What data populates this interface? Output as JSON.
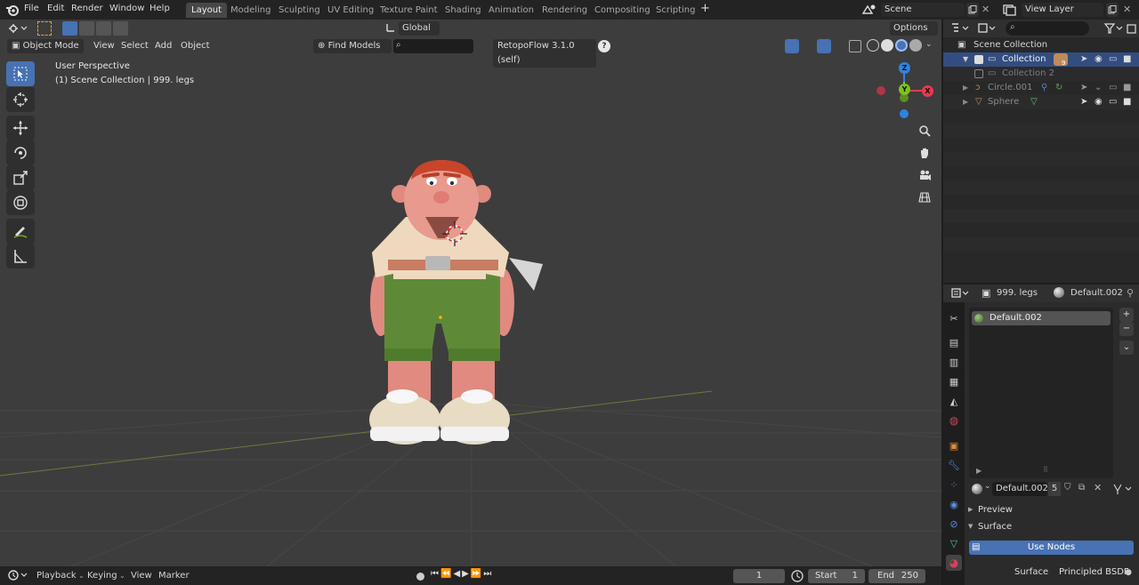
{
  "topbar": {
    "menus": [
      "File",
      "Edit",
      "Render",
      "Window",
      "Help"
    ],
    "workspaces": [
      "Layout",
      "Modeling",
      "Sculpting",
      "UV Editing",
      "Texture Paint",
      "Shading",
      "Animation",
      "Rendering",
      "Compositing",
      "Scripting"
    ],
    "add_workspace": "+",
    "scene_name": "Scene",
    "view_layer_name": "View Layer"
  },
  "viewport_header": {
    "mode": "Object Mode",
    "menus": [
      "View",
      "Select",
      "Add",
      "Object"
    ],
    "transform_orientation": "Global",
    "options": "Options",
    "find_models": "Find Models",
    "retopoflow": "RetopoFlow 3.1.0 (self)"
  },
  "viewport": {
    "perspective_label": "User Perspective",
    "context_label": "(1) Scene Collection | 999. legs",
    "gizmo": {
      "x": "X",
      "y": "Y",
      "z": "Z"
    },
    "accent_colors": {
      "x": "#e8394f",
      "y": "#7dc21d",
      "z": "#2f83e3"
    }
  },
  "outliner": {
    "root": "Scene Collection",
    "items": [
      {
        "label": "Collection",
        "badge": "9"
      },
      {
        "label": "Collection 2"
      },
      {
        "label": "Circle.001"
      },
      {
        "label": "Sphere"
      }
    ]
  },
  "properties": {
    "object_name": "999. legs",
    "material_header": "Default.002",
    "slot_name": "Default.002",
    "material_name": "Default.002",
    "user_count": "5",
    "sections": {
      "preview": "Preview",
      "surface": "Surface"
    },
    "use_nodes": "Use Nodes",
    "surface_label": "Surface",
    "surface_value": "Principled BSDF"
  },
  "timeline": {
    "menus": [
      "Playback",
      "Keying",
      "View",
      "Marker"
    ],
    "current_frame": "1",
    "start_label": "Start",
    "start_value": "1",
    "end_label": "End",
    "end_value": "250"
  }
}
